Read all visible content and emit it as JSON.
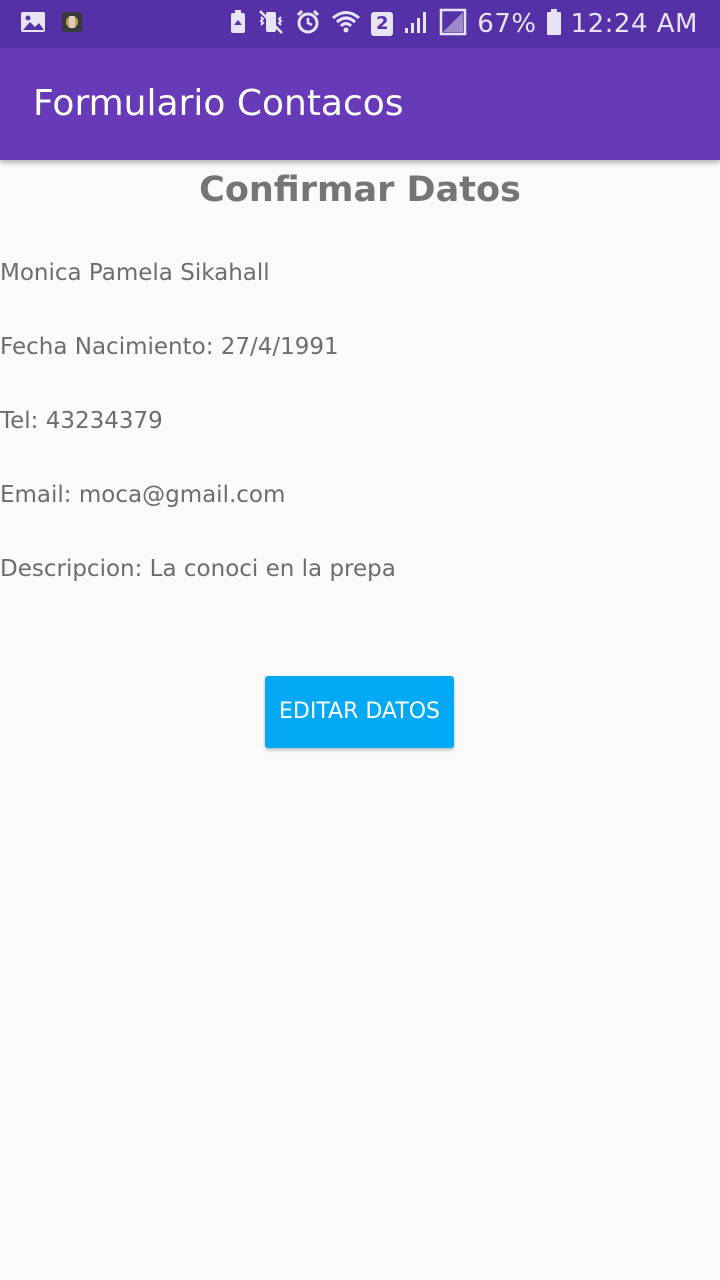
{
  "status_bar": {
    "left_icons": [
      "gallery-icon",
      "app-notification-icon"
    ],
    "right_icons": [
      "saver-icon",
      "vibrate-mute-icon",
      "alarm-icon",
      "wifi-icon",
      "sim2-icon",
      "signal-icon",
      "signal-empty-icon",
      "battery-icon"
    ],
    "sim_badge": "2",
    "battery": "67%",
    "time": "12:24 AM",
    "background_color": "#5531a8"
  },
  "app_bar": {
    "title": "Formulario Contacos",
    "background_color": "#673ab7"
  },
  "confirm": {
    "heading": "Confirmar Datos",
    "name": "Monica Pamela Sikahall",
    "birthdate": "Fecha Nacimiento: 27/4/1991",
    "phone": "Tel: 43234379",
    "email": "Email: moca@gmail.com",
    "description": "Descripcion: La conoci en la prepa",
    "edit_button_label": "EDITAR DATOS",
    "button_color": "#03a9f4"
  }
}
